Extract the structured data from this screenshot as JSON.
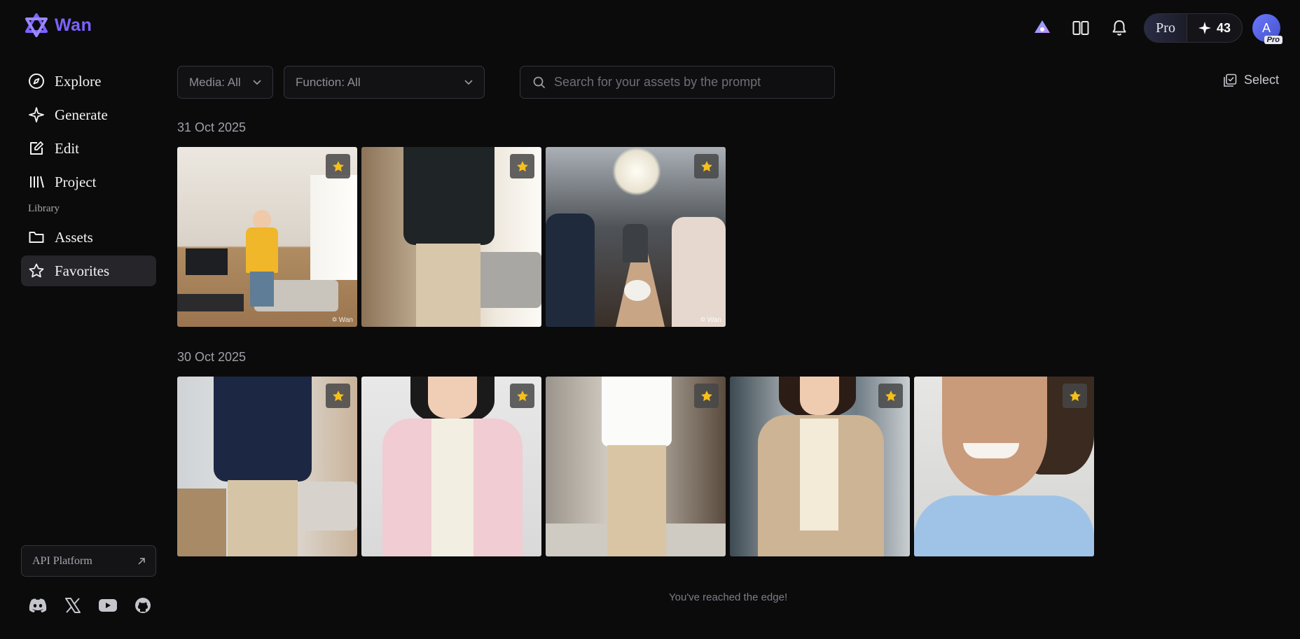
{
  "app": {
    "name": "Wan",
    "brand_color": "#7b63ff"
  },
  "header": {
    "plan": "Pro",
    "credits": "43",
    "avatar_initial": "A",
    "avatar_badge": "Pro"
  },
  "sidebar": {
    "items": [
      {
        "label": "Explore",
        "icon": "compass-icon"
      },
      {
        "label": "Generate",
        "icon": "sparkle-icon"
      },
      {
        "label": "Edit",
        "icon": "edit-icon"
      },
      {
        "label": "Project",
        "icon": "library-icon"
      }
    ],
    "section_label": "Library",
    "library_items": [
      {
        "label": "Assets",
        "icon": "folder-icon"
      },
      {
        "label": "Favorites",
        "icon": "star-icon",
        "active": true
      }
    ],
    "api_platform": "API Platform"
  },
  "toolbar": {
    "media_filter": "Media: All",
    "function_filter": "Function: All",
    "search_placeholder": "Search for your assets by the prompt",
    "select_label": "Select"
  },
  "groups": [
    {
      "date": "31 Oct 2025",
      "count": 3
    },
    {
      "date": "30 Oct 2025",
      "count": 5
    }
  ],
  "footer_message": "You've reached the edge!",
  "watermark": "Wan"
}
